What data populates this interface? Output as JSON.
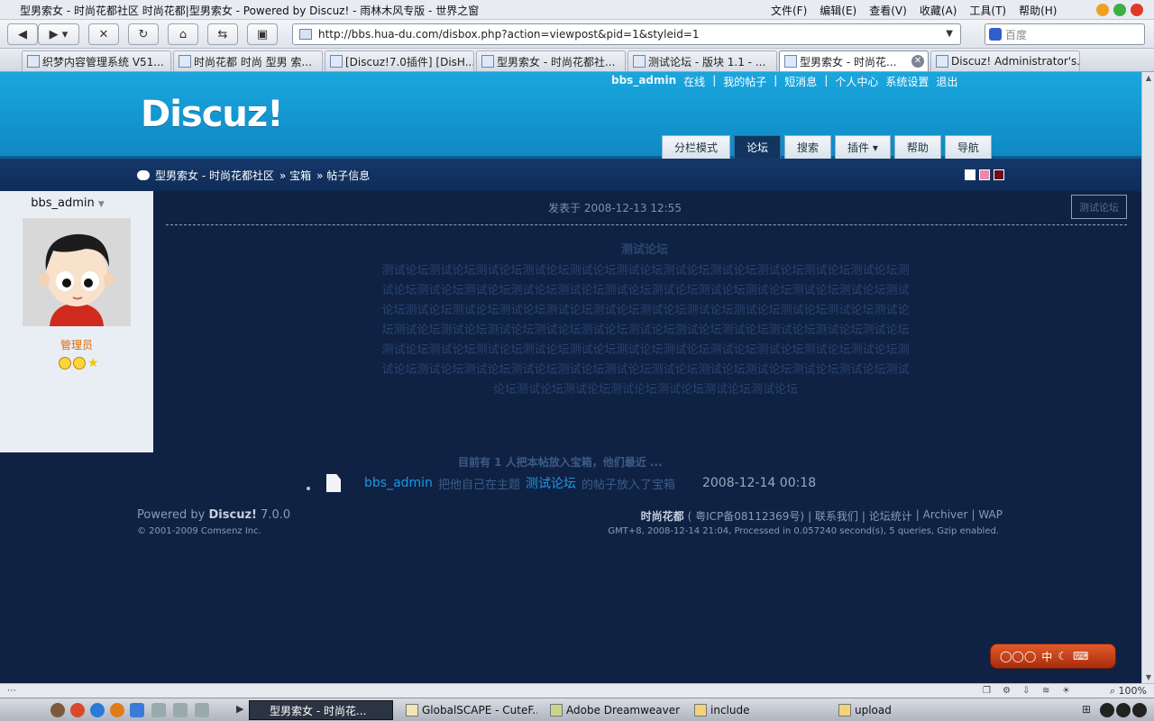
{
  "browser": {
    "title": "型男索女 - 时尚花都社区 时尚花都|型男索女 - Powered by Discuz! - 雨林木风专版 - 世界之窗",
    "menus": [
      "文件(F)",
      "编辑(E)",
      "查看(V)",
      "收藏(A)",
      "工具(T)",
      "帮助(H)"
    ],
    "url": "http://bbs.hua-du.com/disbox.php?action=viewpost&pid=1&styleid=1",
    "search_placeholder": "百度",
    "tabs": [
      {
        "label": "织梦内容管理系统 V51..."
      },
      {
        "label": "时尚花都 时尚 型男 索..."
      },
      {
        "label": "[Discuz!7.0插件] [DisH..."
      },
      {
        "label": "型男索女 - 时尚花都社..."
      },
      {
        "label": "测试论坛 - 版块 1.1 - ..."
      },
      {
        "label": "型男索女 - 时尚花..."
      },
      {
        "label": "Discuz! Administrator's..."
      }
    ],
    "status_zoom": "100%"
  },
  "header": {
    "logo": "Discuz!",
    "user": "bbs_admin",
    "online": "在线",
    "links": [
      "我的帖子",
      "短消息",
      "个人中心",
      "系统设置",
      "退出"
    ],
    "nav": [
      {
        "label": "分栏模式"
      },
      {
        "label": "论坛"
      },
      {
        "label": "搜索"
      },
      {
        "label": "插件 ▾"
      },
      {
        "label": "帮助"
      },
      {
        "label": "导航"
      }
    ]
  },
  "breadcrumb": {
    "items": [
      "型男索女 - 时尚花都社区",
      "» 宝箱",
      "» 帖子信息"
    ]
  },
  "sidebar": {
    "username": "bbs_admin",
    "role": "管理员"
  },
  "post": {
    "meta": "发表于  2008-12-13 12:55",
    "tag_button": "测试论坛",
    "title": "测试论坛",
    "body": "测试论坛测试论坛测试论坛测试论坛测试论坛测试论坛测试论坛测试论坛测试论坛测试论坛测试论坛测试论坛测试论坛测试论坛测试论坛测试论坛测试论坛测试论坛测试论坛测试论坛测试论坛测试论坛测试论坛测试论坛测试论坛测试论坛测试论坛测试论坛测试论坛测试论坛测试论坛测试论坛测试论坛测试论坛测试论坛测试论坛测试论坛测试论坛测试论坛测试论坛测试论坛测试论坛测试论坛测试论坛测试论坛测试论坛测试论坛测试论坛测试论坛测试论坛测试论坛测试论坛测试论坛测试论坛测试论坛测试论坛测试论坛测试论坛测试论坛测试论坛测试论坛测试论坛测试论坛测试论坛测试论坛测试论坛测试论坛测试论坛测试论坛测试论坛测试论坛测试论坛测试论坛测试论坛",
    "box_note": "目前有  1 人把本帖放入宝箱，他们最近 ...",
    "box_user": "bbs_admin",
    "box_text1": "把他自己在主题",
    "box_topic": "测试论坛",
    "box_text2": "的帖子放入了宝箱",
    "box_date": "2008-12-14 00:18"
  },
  "footer": {
    "powered": "Powered by",
    "brand": "Discuz!",
    "version": "7.0.0",
    "copyright": "© 2001-2009 Comsenz Inc.",
    "site": "时尚花都",
    "icp": "( 粤ICP备08112369号)",
    "links": [
      "| 联系我们",
      "| 论坛统计",
      "| Archiver",
      "| WAP"
    ],
    "info": "GMT+8, 2008-12-14 21:04, Processed in 0.057240 second(s), 5 queries, Gzip enabled."
  },
  "ime": {
    "label": "中"
  },
  "taskbar": {
    "items": [
      {
        "label": "型男索女 - 时尚花..."
      },
      {
        "label": "GlobalSCAPE - CuteF..."
      },
      {
        "label": "Adobe Dreamweaver ..."
      },
      {
        "label": "include"
      },
      {
        "label": "upload"
      }
    ]
  }
}
